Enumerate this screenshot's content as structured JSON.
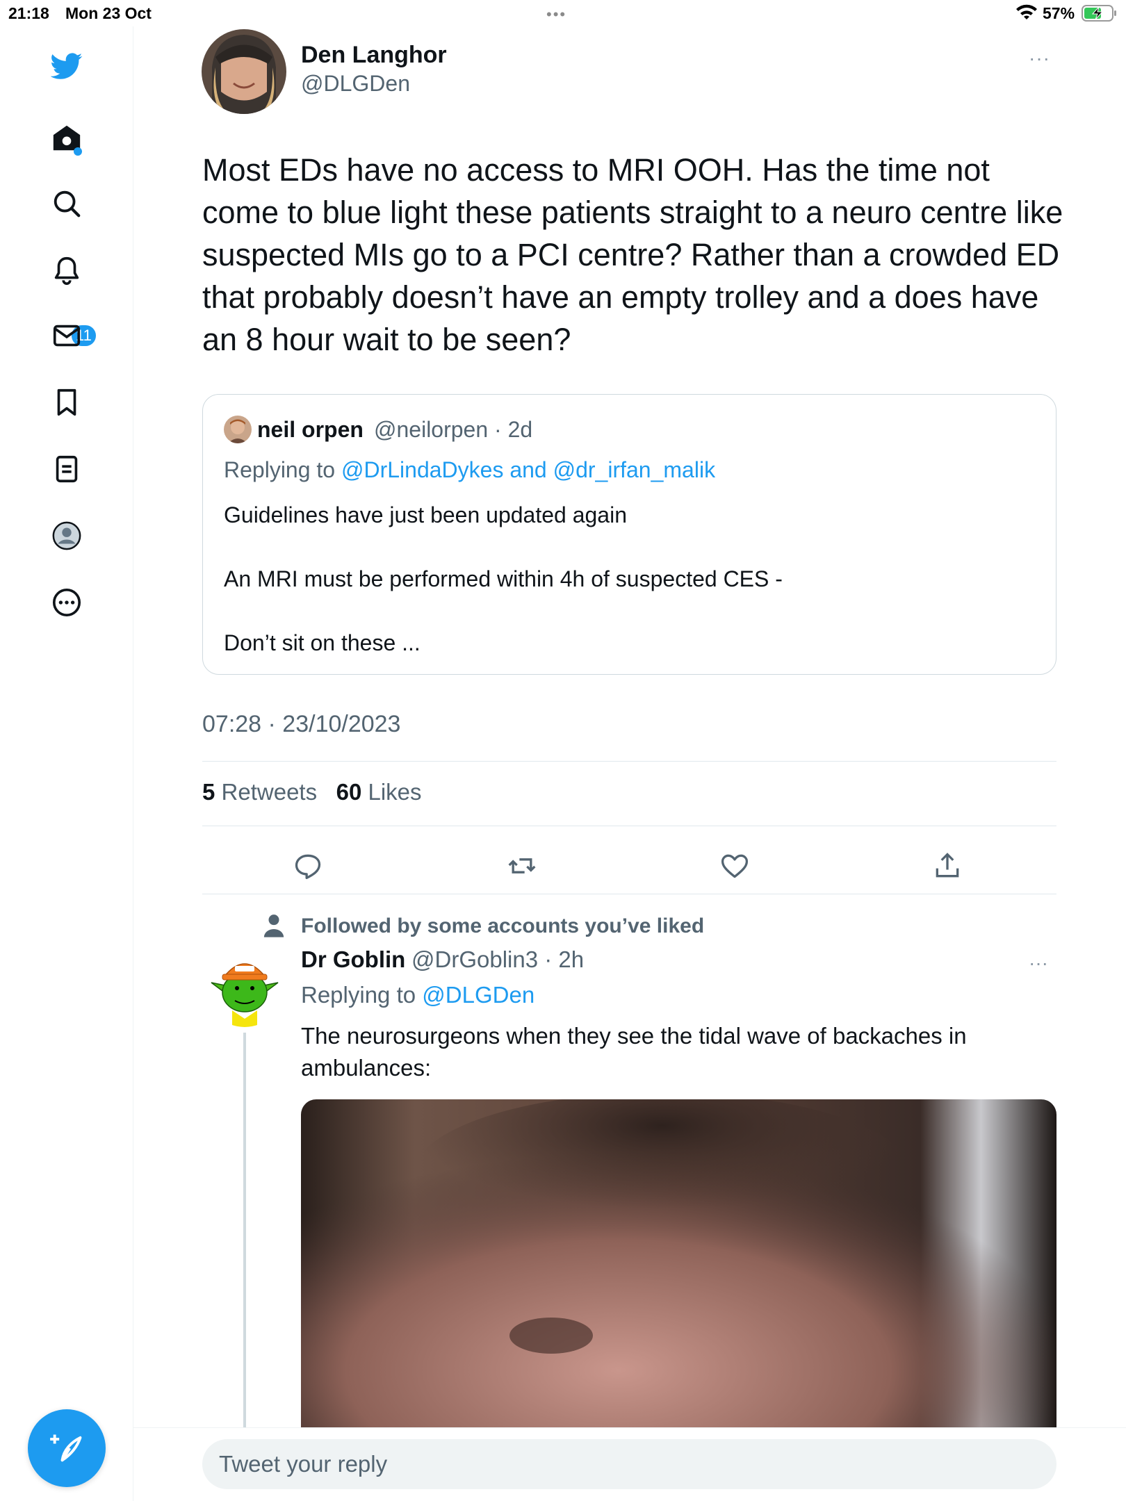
{
  "status_bar": {
    "time": "21:18",
    "date": "Mon 23 Oct",
    "battery": "57%"
  },
  "sidebar": {
    "items": [
      {
        "name": "twitter-logo",
        "icon": "bird-icon"
      },
      {
        "name": "home",
        "icon": "home-icon"
      },
      {
        "name": "explore",
        "icon": "search-icon"
      },
      {
        "name": "notifications",
        "icon": "bell-icon",
        "badge": "11"
      },
      {
        "name": "messages",
        "icon": "mail-icon"
      },
      {
        "name": "bookmarks",
        "icon": "bookmark-icon"
      },
      {
        "name": "lists",
        "icon": "list-icon"
      },
      {
        "name": "profile",
        "icon": "avatar-icon"
      },
      {
        "name": "more",
        "icon": "more-circle-icon"
      }
    ],
    "notification_badge": "11"
  },
  "tweet": {
    "author_name": "Den Langhor",
    "author_handle": "@DLGDen",
    "more": "···",
    "text": "Most EDs have no access to MRI OOH. Has the time not come to blue light these patients straight to a neuro centre like suspected MIs go to a PCI centre? Rather than a crowded ED that probably doesn’t have an empty trolley and a does have an 8 hour wait to be seen?",
    "timestamp": "07:28 · 23/10/2023",
    "retweets_count": "5",
    "retweets_label": "Retweets",
    "likes_count": "60",
    "likes_label": "Likes"
  },
  "quote": {
    "name": "neil orpen",
    "handle_time": "@neilorpen · 2d",
    "replying_prefix": "Replying to",
    "replying_to": "@DrLindaDykes and @dr_irfan_malik",
    "line1": "Guidelines have just been updated again",
    "line2": "An MRI must be performed within 4h of suspected CES -",
    "line3": "Don’t sit on these ..."
  },
  "reply": {
    "followed_note": "Followed by some accounts you’ve liked",
    "name": "Dr Goblin",
    "handle_time": "@DrGoblin3 · 2h",
    "more": "···",
    "replying_prefix": "Replying to",
    "replying_to": "@DLGDen",
    "text": "The neurosurgeons when they see the tidal wave of backaches in ambulances:"
  },
  "reply_box": {
    "placeholder": "Tweet your reply"
  },
  "colors": {
    "accent": "#1d9bf0",
    "text_primary": "#0f1419",
    "text_secondary": "#536471",
    "border": "#cfd9de"
  }
}
